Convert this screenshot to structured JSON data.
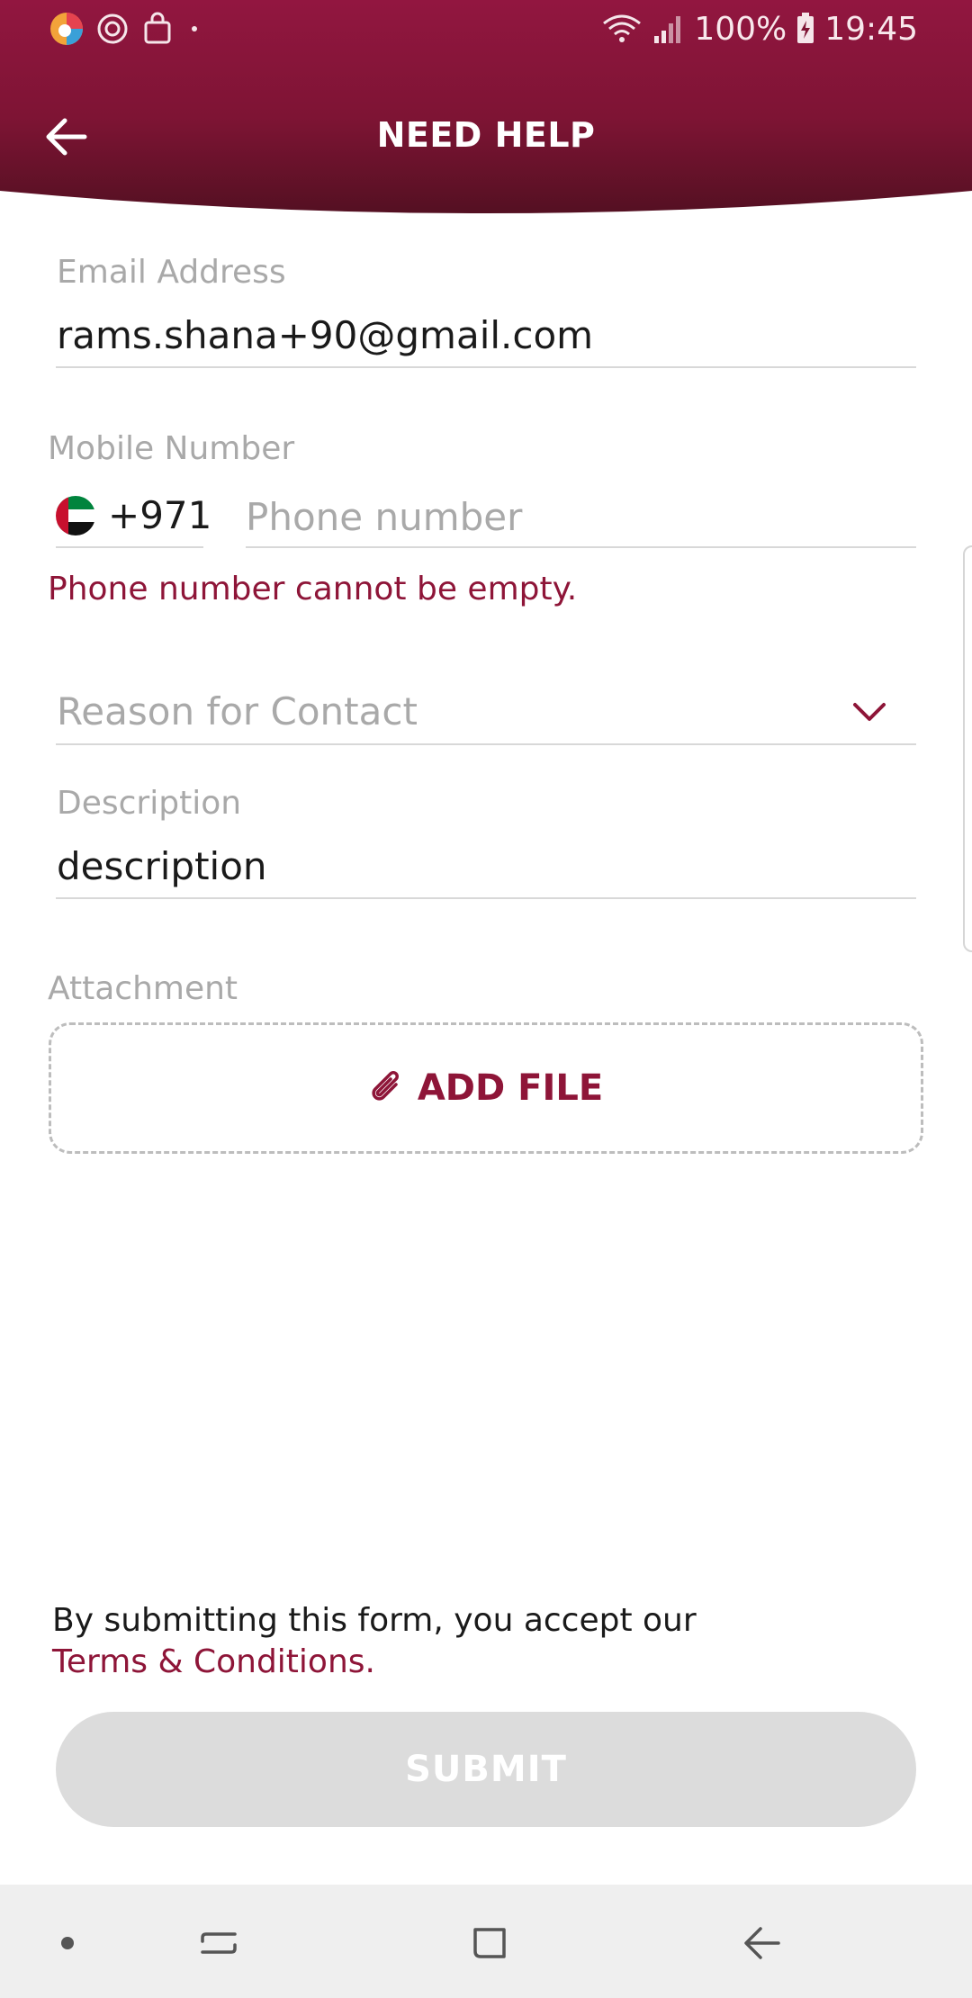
{
  "status_bar": {
    "battery": "100%",
    "time": "19:45"
  },
  "header": {
    "title": "NEED HELP",
    "back_icon": "arrow-left-icon"
  },
  "form": {
    "email": {
      "label": "Email Address",
      "value": "rams.shana+90@gmail.com"
    },
    "mobile": {
      "label": "Mobile Number",
      "country_code": "+971",
      "placeholder": "Phone number",
      "error": "Phone number cannot be empty."
    },
    "reason": {
      "placeholder": "Reason for Contact"
    },
    "description": {
      "label": "Description",
      "value": "description"
    },
    "attachment": {
      "label": "Attachment",
      "button_label": "ADD FILE"
    }
  },
  "footer": {
    "terms_text": "By submitting this form, you accept our",
    "terms_link": "Terms & Conditions.",
    "submit_label": "SUBMIT"
  },
  "colors": {
    "brand": "#8e1538",
    "brand_dark": "#5a0f22",
    "disabled": "#dcdcdc"
  }
}
